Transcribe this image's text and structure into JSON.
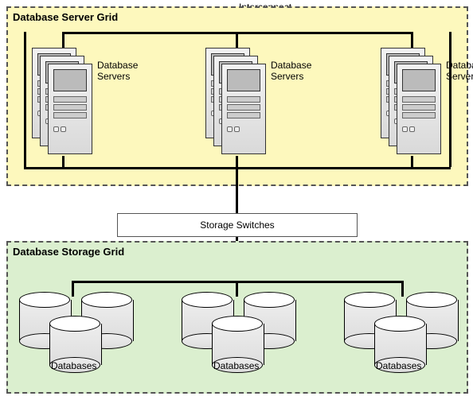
{
  "interconnect_label": "Interconnect",
  "storage_switch_label": "Storage Switches",
  "server_grid": {
    "title": "Database Server Grid",
    "clusters": [
      {
        "label": "Database\nServers"
      },
      {
        "label": "Database\nServers"
      },
      {
        "label": "Database\nServers"
      }
    ]
  },
  "storage_grid": {
    "title": "Database Storage Grid",
    "clusters": [
      {
        "label": "Databases"
      },
      {
        "label": "Databases"
      },
      {
        "label": "Databases"
      }
    ]
  }
}
